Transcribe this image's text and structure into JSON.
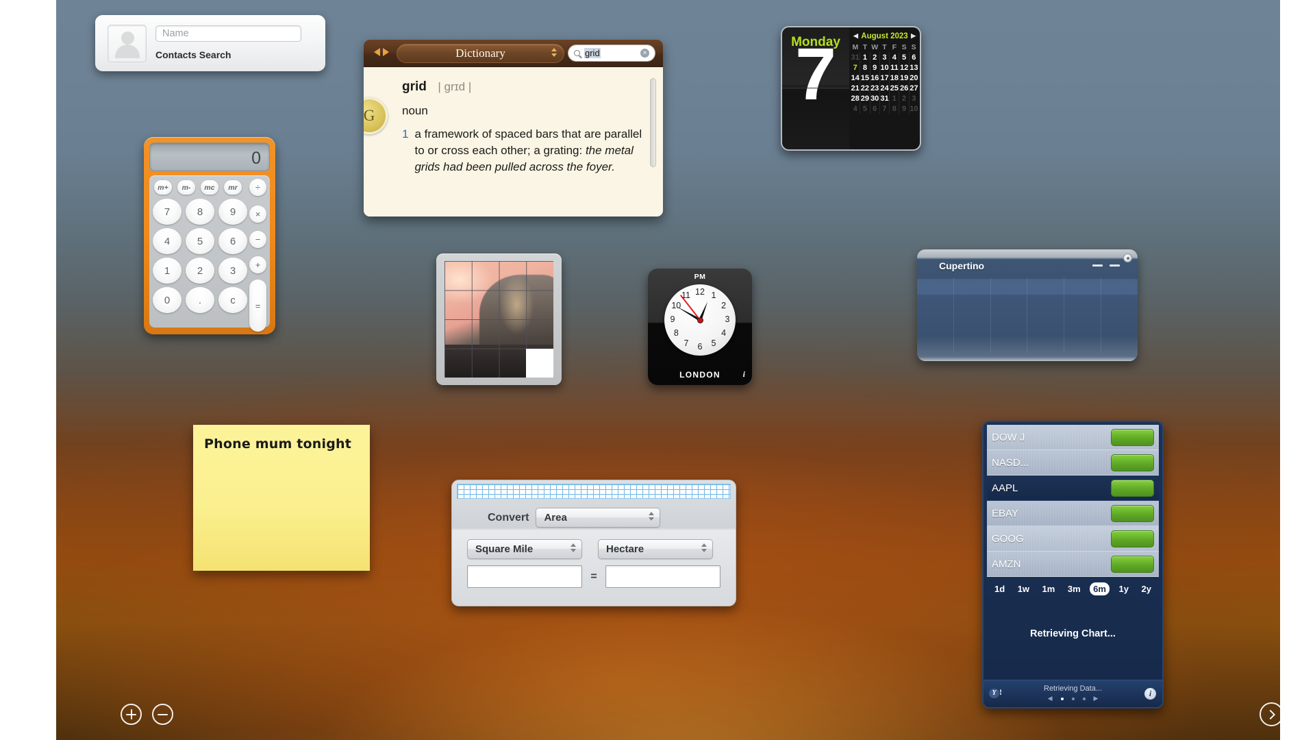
{
  "contacts": {
    "name_placeholder": "Name",
    "title": "Contacts Search"
  },
  "calculator": {
    "display": "0",
    "memory_keys": [
      "m+",
      "m-",
      "mc",
      "mr"
    ],
    "number_keys": [
      "7",
      "8",
      "9",
      "4",
      "5",
      "6",
      "1",
      "2",
      "3",
      "0",
      ".",
      "c"
    ],
    "operator_keys": [
      "÷",
      "×",
      "−",
      "+"
    ],
    "equals_key": "="
  },
  "dictionary": {
    "source": "Dictionary",
    "search_value": "grid",
    "badge": "G",
    "headword": "grid",
    "pronunciation": "| grɪd |",
    "part_of_speech": "noun",
    "sense_number": "1",
    "definition_plain": "a framework of spaced bars that are parallel to or cross each other; a grating:",
    "definition_example": "the metal grids had been pulled across the foyer."
  },
  "calendar": {
    "weekday": "Monday",
    "day_number": "7",
    "month_year": "August 2023",
    "weekday_headers": [
      "M",
      "T",
      "W",
      "T",
      "F",
      "S",
      "S"
    ],
    "weeks": [
      [
        {
          "d": "31",
          "dim": true
        },
        {
          "d": "1"
        },
        {
          "d": "2"
        },
        {
          "d": "3"
        },
        {
          "d": "4"
        },
        {
          "d": "5"
        },
        {
          "d": "6"
        }
      ],
      [
        {
          "d": "7",
          "today": true
        },
        {
          "d": "8"
        },
        {
          "d": "9"
        },
        {
          "d": "10"
        },
        {
          "d": "11"
        },
        {
          "d": "12"
        },
        {
          "d": "13"
        }
      ],
      [
        {
          "d": "14"
        },
        {
          "d": "15"
        },
        {
          "d": "16"
        },
        {
          "d": "17"
        },
        {
          "d": "18"
        },
        {
          "d": "19"
        },
        {
          "d": "20"
        }
      ],
      [
        {
          "d": "21"
        },
        {
          "d": "22"
        },
        {
          "d": "23"
        },
        {
          "d": "24"
        },
        {
          "d": "25"
        },
        {
          "d": "26"
        },
        {
          "d": "27"
        }
      ],
      [
        {
          "d": "28"
        },
        {
          "d": "29"
        },
        {
          "d": "30"
        },
        {
          "d": "31"
        },
        {
          "d": "1",
          "dim": true
        },
        {
          "d": "2",
          "dim": true
        },
        {
          "d": "3",
          "dim": true
        }
      ],
      [
        {
          "d": "4",
          "dim": true
        },
        {
          "d": "5",
          "dim": true
        },
        {
          "d": "6",
          "dim": true
        },
        {
          "d": "7",
          "dim": true
        },
        {
          "d": "8",
          "dim": true
        },
        {
          "d": "9",
          "dim": true
        },
        {
          "d": "10",
          "dim": true
        }
      ]
    ],
    "prev_label": "◀",
    "next_label": "▶"
  },
  "tile_game": {
    "grid": "4x4",
    "blank_tile": "bottom-right"
  },
  "world_clock": {
    "meridiem": "PM",
    "city": "LONDON",
    "hour_numerals": [
      "12",
      "1",
      "2",
      "3",
      "4",
      "5",
      "6",
      "7",
      "8",
      "9",
      "10",
      "11"
    ],
    "info_label": "i"
  },
  "weather": {
    "city": "Cupertino",
    "high": "—",
    "low": "—"
  },
  "stocks": {
    "rows": [
      {
        "symbol": "DOW J",
        "selected": false
      },
      {
        "symbol": "NASD...",
        "selected": false
      },
      {
        "symbol": "AAPL",
        "selected": true
      },
      {
        "symbol": "EBAY",
        "selected": false
      },
      {
        "symbol": "GOOG",
        "selected": false
      },
      {
        "symbol": "AMZN",
        "selected": false
      }
    ],
    "ranges": [
      "1d",
      "1w",
      "1m",
      "3m",
      "6m",
      "1y",
      "2y"
    ],
    "selected_range": "6m",
    "chart_status": "Retrieving Chart...",
    "data_status": "Retrieving Data...",
    "provider": "Y!",
    "info_label": "i",
    "accent_green": "#5fa926"
  },
  "sticky_note": {
    "text": "Phone mum tonight"
  },
  "converter": {
    "convert_label": "Convert",
    "category": "Area",
    "from_unit": "Square Mile",
    "to_unit": "Hectare",
    "from_value": "",
    "to_value": "",
    "equals": "="
  },
  "controls": {
    "add_label": "+",
    "remove_label": "−",
    "next_label": "›"
  }
}
